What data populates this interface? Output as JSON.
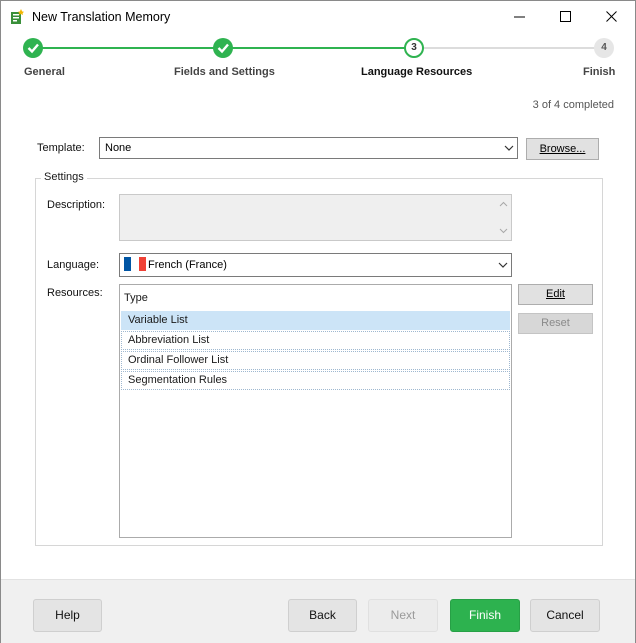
{
  "window": {
    "title": "New Translation Memory",
    "icon": "translation-memory-icon"
  },
  "wizard": {
    "steps": [
      {
        "number": "1",
        "label": "General",
        "state": "completed"
      },
      {
        "number": "2",
        "label": "Fields and Settings",
        "state": "completed"
      },
      {
        "number": "3",
        "label": "Language Resources",
        "state": "current"
      },
      {
        "number": "4",
        "label": "Finish",
        "state": "pending"
      }
    ],
    "progress_text": "3 of 4 completed",
    "accent_color": "#2fb350"
  },
  "form": {
    "template_label": "Template:",
    "template_value": "None",
    "browse_label": "Browse...",
    "settings_group_title": "Settings",
    "description_label": "Description:",
    "description_value": "",
    "language_label": "Language:",
    "language_value": "French (France)",
    "language_flag": "france-flag-icon",
    "resources_label": "Resources:",
    "resources_column_header": "Type",
    "resources": [
      {
        "type": "Variable List",
        "selected": true
      },
      {
        "type": "Abbreviation List",
        "selected": false
      },
      {
        "type": "Ordinal Follower List",
        "selected": false
      },
      {
        "type": "Segmentation Rules",
        "selected": false
      }
    ],
    "edit_label": "Edit",
    "reset_label": "Reset"
  },
  "footer": {
    "help_label": "Help",
    "back_label": "Back",
    "next_label": "Next",
    "finish_label": "Finish",
    "cancel_label": "Cancel"
  }
}
